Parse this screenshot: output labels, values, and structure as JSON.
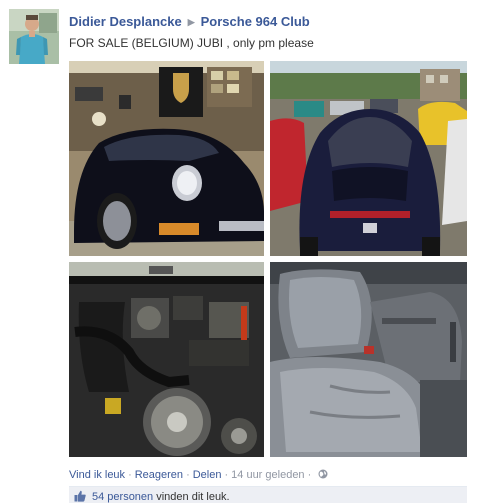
{
  "post": {
    "author": "Didier Desplancke",
    "group": "Porsche 964 Club",
    "message": "FOR SALE (BELGIUM) JUBI , only pm please"
  },
  "actions": {
    "like": "Vind ik leuk",
    "comment": "Reageren",
    "share": "Delen",
    "timestamp": "14 uur geleden",
    "separator": "·"
  },
  "likes": {
    "count_link": "54 personen",
    "suffix": "vinden dit leuk."
  },
  "photos": [
    {
      "subject": "black-porsche-964-front-in-garage"
    },
    {
      "subject": "dark-blue-porsche-964-rear-at-car-meet"
    },
    {
      "subject": "porsche-964-engine-bay"
    },
    {
      "subject": "grey-leather-seats-interior"
    }
  ],
  "colors": {
    "link": "#3b5998",
    "meta": "#9197a3",
    "like_bar": "#edeff4"
  },
  "icons": {
    "privacy": "globe-icon",
    "like": "thumbs-up-icon",
    "breadcrumb": "triangle-right-icon"
  }
}
